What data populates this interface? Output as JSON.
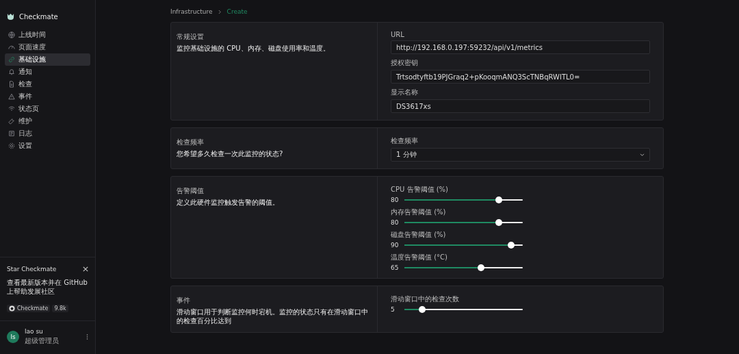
{
  "app": {
    "name": "Checkmate"
  },
  "sidebar": {
    "items": [
      {
        "label": "上线时间",
        "selected": false
      },
      {
        "label": "页面速度",
        "selected": false
      },
      {
        "label": "基础设施",
        "selected": true
      },
      {
        "label": "通知",
        "selected": false
      },
      {
        "label": "检查",
        "selected": false
      },
      {
        "label": "事件",
        "selected": false
      },
      {
        "label": "状态页",
        "selected": false
      },
      {
        "label": "维护",
        "selected": false
      },
      {
        "label": "日志",
        "selected": false
      },
      {
        "label": "设置",
        "selected": false
      }
    ]
  },
  "promo": {
    "title": "Star Checkmate",
    "text": "查看最新版本并在 GitHub 上帮助发展社区",
    "repo": "Checkmate",
    "stars_count": "9.8k"
  },
  "user": {
    "initials": "ls",
    "name": "lao su",
    "role": "超级管理员"
  },
  "breadcrumb": [
    {
      "label": "Infrastructure",
      "selected": false
    },
    {
      "label": "Create",
      "selected": true
    }
  ],
  "sections": [
    {
      "title": "常规设置",
      "description": "监控基础设施的 CPU、内存、磁盘使用率和温度。",
      "fields": [
        {
          "kind": "text",
          "label": "URL",
          "value": "http://192.168.0.197:59232/api/v1/metrics"
        },
        {
          "kind": "text",
          "label": "授权密钥",
          "value": "Trtsodtyftb19PJGraq2+pKooqmANQ3ScTNBqRWITL0="
        },
        {
          "kind": "text",
          "label": "显示名称",
          "value": "DS3617xs"
        }
      ]
    },
    {
      "title": "检查频率",
      "description": "您希望多久检查一次此监控的状态?",
      "fields": [
        {
          "kind": "select",
          "label": "检查频率",
          "value": "1 分钟"
        }
      ]
    },
    {
      "title": "告警阈值",
      "description": "定义此硬件监控触发告警的阈值。",
      "fields": [
        {
          "kind": "slider",
          "label": "CPU 告警阈值 (%)",
          "value": "80",
          "level": 0.8
        },
        {
          "kind": "slider",
          "label": "内存告警阈值 (%)",
          "value": "80",
          "level": 0.8
        },
        {
          "kind": "slider",
          "label": "磁盘告警阈值 (%)",
          "value": "90",
          "level": 0.9
        },
        {
          "kind": "slider",
          "label": "温度告警阈值 (°C)",
          "value": "65",
          "level": 0.65
        }
      ]
    },
    {
      "title": "事件",
      "description": "滑动窗口用于判断监控何时宕机。监控的状态只有在滑动窗口中的检查百分比达到",
      "fields": [
        {
          "kind": "slider",
          "label": "滑动窗口中的检查次数",
          "value": "5",
          "level": 0.15
        }
      ]
    }
  ]
}
